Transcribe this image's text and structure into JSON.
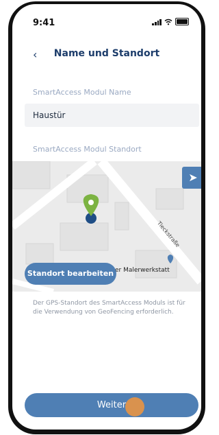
{
  "status": {
    "time": "9:41"
  },
  "nav": {
    "back_icon": "chevron-left-icon",
    "title": "Name und Standort"
  },
  "form": {
    "name_label": "SmartAccess Modul Name",
    "name_value": "Haustür",
    "location_label": "SmartAccess Modul Standort"
  },
  "map": {
    "street_label": "Tieckstraße",
    "poi_label": "er Malerwerkstatt",
    "edit_button": "Standort bearbeiten",
    "locate_icon": "navigation-arrow-icon",
    "pin_color": "#7cb342"
  },
  "info_text": "Der GPS-Standort des SmartAccess Moduls ist für die Verwendung von GeoFencing erforderlich.",
  "footer": {
    "next_button": "Weiter"
  },
  "colors": {
    "primary": "#4f7fb4",
    "title": "#1d3d6b",
    "touch": "#e89542"
  }
}
